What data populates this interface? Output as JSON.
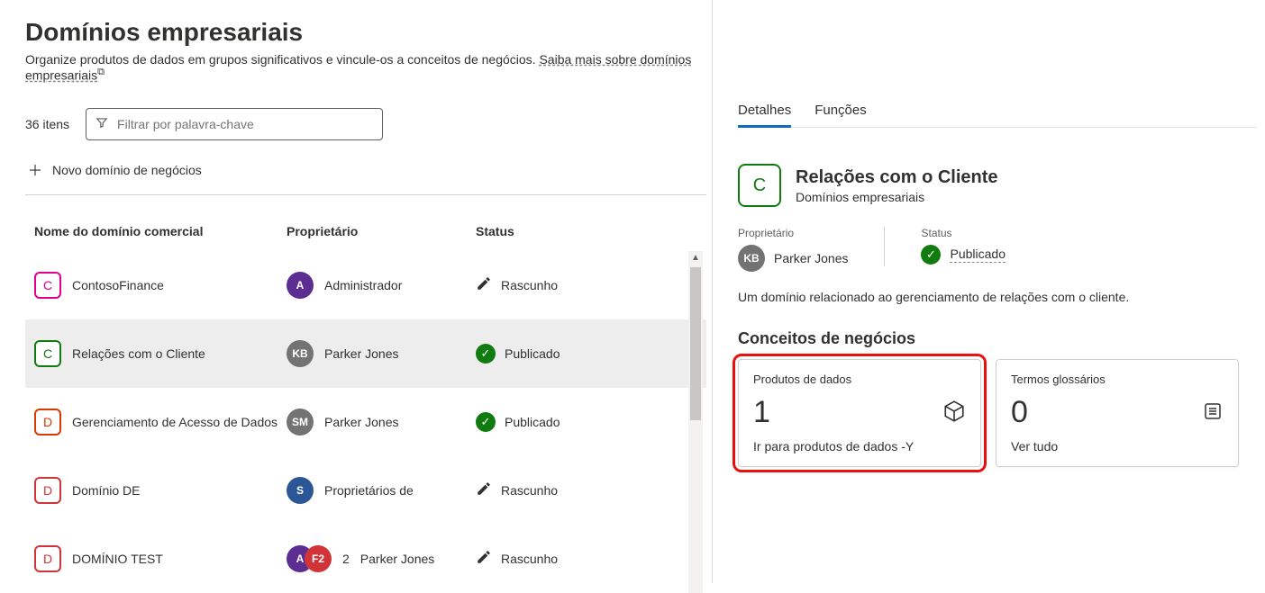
{
  "page": {
    "title": "Domínios empresariais",
    "description_pre": "Organize produtos de dados em grupos significativos e vincule-os a conceitos de negócios. ",
    "description_link": "Saiba mais sobre domínios empresariais"
  },
  "toolbar": {
    "count": "36",
    "count_unit": "itens",
    "filter_placeholder": "Filtrar por palavra-chave",
    "new_domain_label": "Novo domínio de negócios"
  },
  "columns": {
    "name": "Nome do domínio comercial",
    "owner": "Proprietário",
    "status": "Status"
  },
  "rows": [
    {
      "badge": "C",
      "badge_class": "badge-pink",
      "name": "ContosoFinance",
      "owner_initials": "A",
      "owner_class": "av-purple",
      "owner_name": "Administrador",
      "status": "Rascunho",
      "status_kind": "draft"
    },
    {
      "badge": "C",
      "badge_class": "badge-green",
      "name": "Relações com o Cliente",
      "owner_initials": "KB",
      "owner_class": "av-grey",
      "owner_name": "Parker Jones",
      "status": "Publicado",
      "status_kind": "published",
      "selected": true
    },
    {
      "badge": "D",
      "badge_class": "badge-orange",
      "name": "Gerenciamento de Acesso de Dados",
      "owner_initials": "SM",
      "owner_class": "av-grey",
      "owner_name": "Parker Jones",
      "status": "Publicado",
      "status_kind": "published"
    },
    {
      "badge": "D",
      "badge_class": "badge-red",
      "name": "Domínio DE",
      "owner_initials": "S",
      "owner_class": "av-blue",
      "owner_name": "Proprietários de",
      "status": "Rascunho",
      "status_kind": "draft"
    },
    {
      "badge": "D",
      "badge_class": "badge-red",
      "name": "DOMÍNIO TEST",
      "owner_initials": "A",
      "owner_class": "av-purple",
      "owner2_initials": "F2",
      "owner2_class": "av-red",
      "owner_count": "2",
      "owner_name": "Parker Jones",
      "status": "Rascunho",
      "status_kind": "draft"
    }
  ],
  "details": {
    "tabs": {
      "details": "Detalhes",
      "roles": "Funções"
    },
    "badge": "C",
    "title": "Relações com o Cliente",
    "subtitle": "Domínios empresariais",
    "owner_label": "Proprietário",
    "owner_initials": "KB",
    "owner_name": "Parker Jones",
    "status_label": "Status",
    "status_value": "Publicado",
    "description": "Um domínio relacionado ao gerenciamento de relações com o cliente.",
    "concepts_heading": "Conceitos de negócios",
    "cards": {
      "products": {
        "title": "Produtos de dados",
        "value": "1",
        "link": "Ir para produtos de dados -Y"
      },
      "glossary": {
        "title": "Termos glossários",
        "value": "0",
        "link": "Ver tudo"
      }
    }
  }
}
